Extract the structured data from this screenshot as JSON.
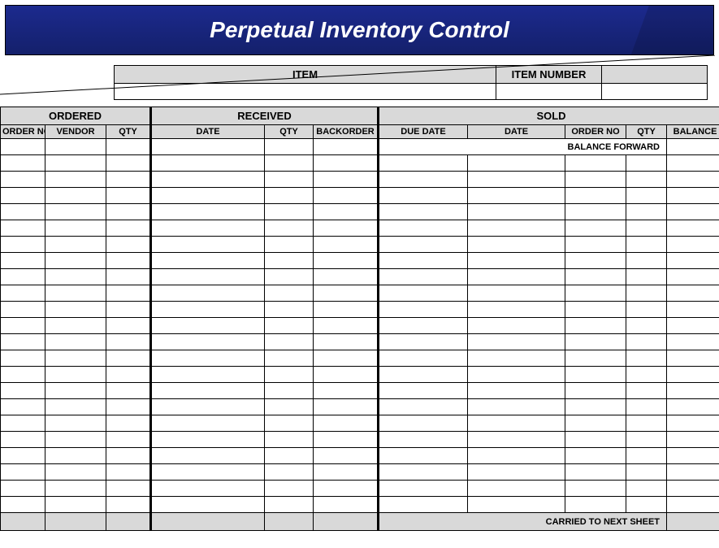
{
  "title": "Perpetual Inventory Control",
  "item_header": {
    "item_label": "ITEM",
    "item_number_label": "ITEM NUMBER",
    "item_value": "",
    "item_number_value": ""
  },
  "sections": {
    "ordered": {
      "label": "ORDERED",
      "columns": [
        "ORDER NO",
        "VENDOR",
        "QTY"
      ]
    },
    "received": {
      "label": "RECEIVED",
      "columns": [
        "DATE",
        "QTY",
        "BACKORDER"
      ]
    },
    "sold": {
      "label": "SOLD",
      "columns": [
        "DUE DATE",
        "DATE",
        "ORDER NO",
        "QTY",
        "BALANCE"
      ]
    }
  },
  "balance_forward_label": "BALANCE FORWARD",
  "footer_label": "CARRIED TO NEXT SHEET",
  "empty_row_count": 22
}
